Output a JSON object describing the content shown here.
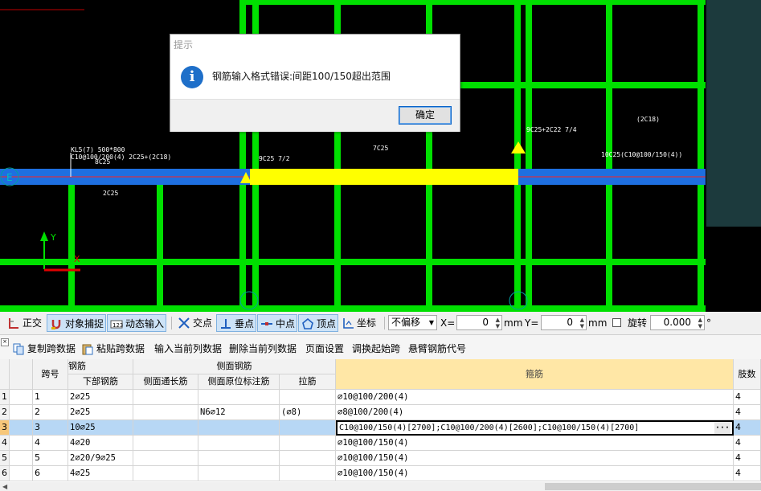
{
  "cad": {
    "axis_label_e": "E",
    "axis_y": "Y",
    "axis_x": "X",
    "beam_label_1": "KL5(7) 500*800",
    "beam_label_2": "C10@100/200(4) 2C25+(2C18)",
    "beam_label_3": "8C25",
    "beam_label_4": "2C25",
    "beam_label_5": "9C25 7/2",
    "beam_label_6": "7C25",
    "beam_label_7": "9C25+2C22 7/4",
    "beam_label_8": "(2C18)",
    "beam_label_9": "10C25(C10@100/150(4))",
    "colors": {
      "column": "#00e000",
      "beam": "#1e6fe0",
      "selected_beam": "#ffff00",
      "background": "#000000"
    }
  },
  "dialog": {
    "title": "提示",
    "message": "钢筋输入格式错误:间距100/150超出范围",
    "ok_label": "确定",
    "icon": "info-icon"
  },
  "snapbar": {
    "ortho": "正交",
    "object_snap": "对象捕捉",
    "dynamic_input": "动态输入",
    "intersection": "交点",
    "perpendicular": "垂点",
    "midpoint": "中点",
    "vertex": "顶点",
    "coordinate": "坐标",
    "offset_mode": "不偏移",
    "x_label": "X=",
    "x_value": "0",
    "y_label": "Y=",
    "y_value": "0",
    "mm1": "mm",
    "mm2": "mm",
    "rotate_label": "旋转",
    "rotate_value": "0.000",
    "degree": "°"
  },
  "actbar": {
    "copy_span": "复制跨数据",
    "paste_span": "粘贴跨数据",
    "input_col": "输入当前列数据",
    "delete_col": "删除当前列数据",
    "page_setup": "页面设置",
    "swap_start": "调换起始跨",
    "cantilever": "悬臂钢筋代号"
  },
  "grid": {
    "headers": {
      "span_no": "跨号",
      "rebar": "钢筋",
      "bottom_rebar": "下部钢筋",
      "side_rebar": "侧面钢筋",
      "side_through": "侧面通长筋",
      "side_in_situ": "侧面原位标注筋",
      "tie": "拉筋",
      "stirrup": "箍筋",
      "legs": "肢数"
    },
    "rows": [
      {
        "n": "1",
        "span": "1",
        "bottom": "2⌀25",
        "side_through": "",
        "side_in_situ": "",
        "tie": "",
        "stirrup": "⌀10@100/200(4)",
        "legs": "4"
      },
      {
        "n": "2",
        "span": "2",
        "bottom": "2⌀25",
        "side_through": "",
        "side_in_situ": "N6⌀12",
        "tie": "(⌀8)",
        "stirrup": "⌀8@100/200(4)",
        "legs": "4"
      },
      {
        "n": "3",
        "span": "3",
        "bottom": "10⌀25",
        "side_through": "",
        "side_in_situ": "",
        "tie": "",
        "stirrup": "C10@100/150(4)[2700];C10@100/200(4)[2600];C10@100/150(4)[2700]",
        "legs": "4"
      },
      {
        "n": "4",
        "span": "4",
        "bottom": "4⌀20",
        "side_through": "",
        "side_in_situ": "",
        "tie": "",
        "stirrup": "⌀10@100/150(4)",
        "legs": "4"
      },
      {
        "n": "5",
        "span": "5",
        "bottom": "2⌀20/9⌀25",
        "side_through": "",
        "side_in_situ": "",
        "tie": "",
        "stirrup": "⌀10@100/150(4)",
        "legs": "4"
      },
      {
        "n": "6",
        "span": "6",
        "bottom": "4⌀25",
        "side_through": "",
        "side_in_situ": "",
        "tie": "",
        "stirrup": "⌀10@100/150(4)",
        "legs": "4"
      }
    ],
    "ellipsis": "···"
  }
}
